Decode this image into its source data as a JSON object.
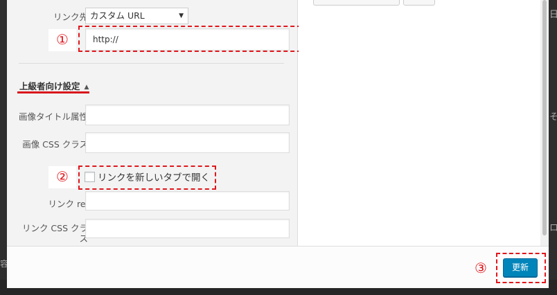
{
  "link_to": {
    "label": "リンク先",
    "selected": "カスタム URL"
  },
  "url_input": {
    "value": "http://"
  },
  "advanced": {
    "title": "上級者向け設定"
  },
  "image_title_attr": {
    "label": "画像タイトル属性",
    "value": ""
  },
  "image_css_class": {
    "label": "画像 CSS クラス",
    "value": ""
  },
  "open_new_tab": {
    "label": "リンクを新しいタブで開く",
    "checked": false
  },
  "link_rel": {
    "label": "リンク rel",
    "value": ""
  },
  "link_css_class": {
    "label_line1": "リンク CSS クラ",
    "label_line2": "ス",
    "value": ""
  },
  "annotations": {
    "n1": "①",
    "n2": "②",
    "n3": "③"
  },
  "footer": {
    "update_label": "更新"
  },
  "colors": {
    "annotation_red": "#e0161b",
    "primary_button": "#0085ba"
  }
}
